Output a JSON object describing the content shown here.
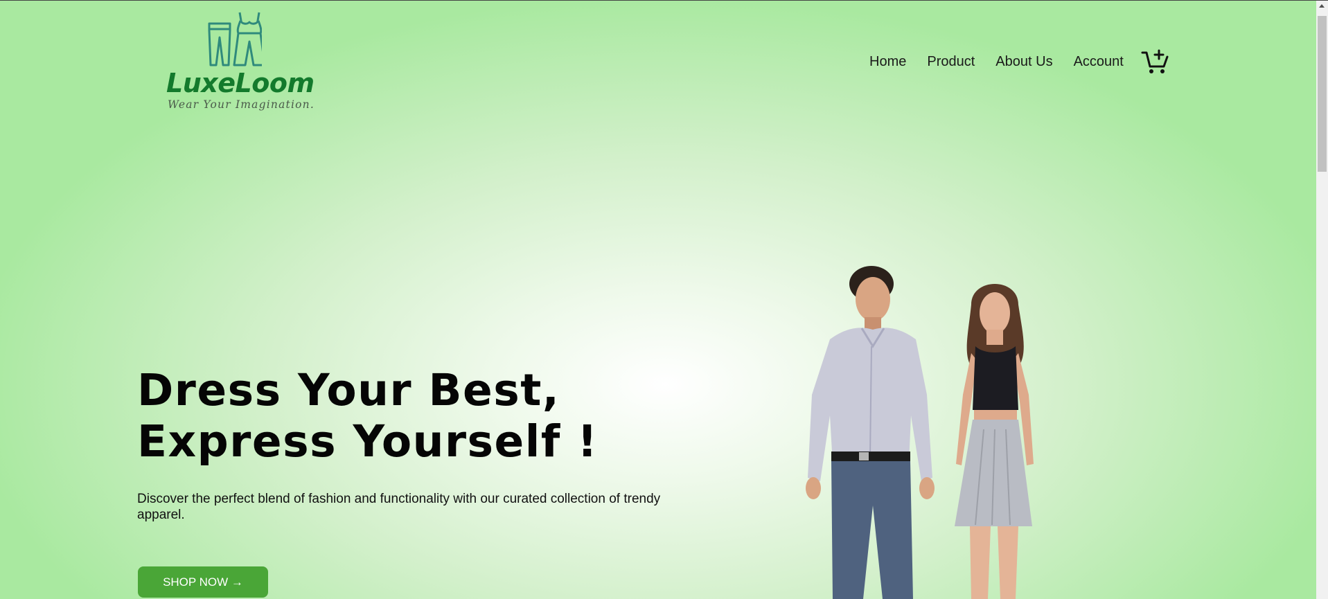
{
  "brand": {
    "name": "LuxeLoom",
    "tagline": "Wear Your Imagination.",
    "logo_icon": "clothing-pants-top-icon",
    "color": "#137a2c"
  },
  "nav": {
    "items": [
      {
        "label": "Home"
      },
      {
        "label": "Product"
      },
      {
        "label": "About Us"
      },
      {
        "label": "Account"
      }
    ],
    "cart_icon": "cart-add-icon"
  },
  "hero": {
    "title_line1": "Dress Your Best,",
    "title_line2": "Express Yourself !",
    "description": "Discover the perfect blend of fashion and functionality with our curated collection of trendy apparel.",
    "cta_label": "SHOP NOW →",
    "cta_color": "#4aa637",
    "image": "models-man-and-woman"
  },
  "theme": {
    "background_center": "#ffffff",
    "background_edge": "#a9e9a0"
  }
}
